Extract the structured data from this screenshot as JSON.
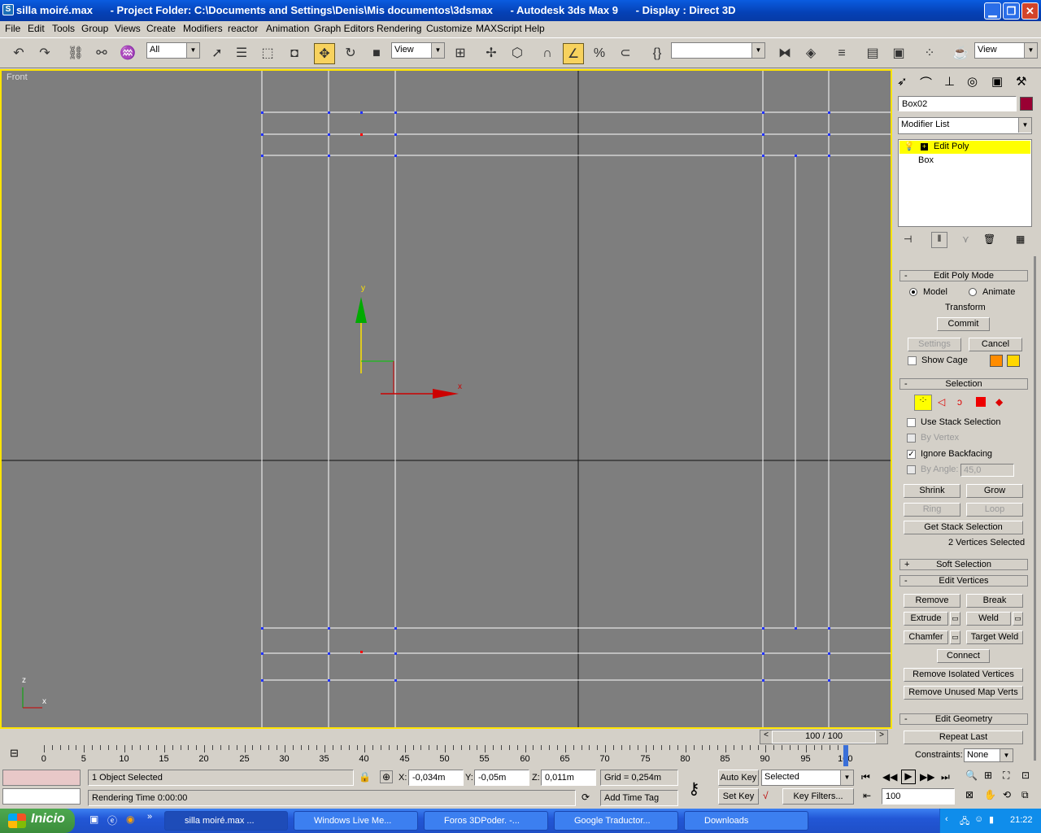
{
  "titlebar": {
    "title": "silla moiré.max      - Project Folder: C:\\Documents and Settings\\Denis\\Mis documentos\\3dsmax      - Autodesk 3ds Max 9      - Display : Direct 3D"
  },
  "menubar": {
    "items": [
      "File",
      "Edit",
      "Tools",
      "Group",
      "Views",
      "Create",
      "Modifiers",
      "reactor",
      "Animation",
      "Graph Editors",
      "Rendering",
      "Customize",
      "MAXScript",
      "Help"
    ]
  },
  "toolbar": {
    "selection_filter": "All",
    "ref_coord": "View",
    "named_sel": "",
    "view_combo": "View"
  },
  "viewport": {
    "label": "Front",
    "gizmo_x": "x",
    "gizmo_y": "y",
    "axis_z": "z",
    "axis_x": "x"
  },
  "cmdpanel": {
    "object_name": "Box02",
    "object_color": "#990033",
    "modifier_list": "Modifier List",
    "stack": [
      "Edit Poly",
      "Box"
    ],
    "edit_poly_mode": {
      "title": "Edit Poly Mode",
      "model": "Model",
      "animate": "Animate",
      "transform": "Transform",
      "commit": "Commit",
      "settings": "Settings",
      "cancel": "Cancel",
      "show_cage": "Show Cage"
    },
    "selection": {
      "title": "Selection",
      "use_stack": "Use Stack Selection",
      "by_vertex": "By Vertex",
      "ignore_backfacing": "Ignore Backfacing",
      "by_angle": "By Angle:",
      "angle_value": "45,0",
      "shrink": "Shrink",
      "grow": "Grow",
      "ring": "Ring",
      "loop": "Loop",
      "get_stack": "Get Stack Selection",
      "status": "2 Vertices Selected"
    },
    "soft_selection": {
      "title": "Soft Selection"
    },
    "edit_vertices": {
      "title": "Edit Vertices",
      "remove": "Remove",
      "break": "Break",
      "extrude": "Extrude",
      "weld": "Weld",
      "chamfer": "Chamfer",
      "target_weld": "Target Weld",
      "connect": "Connect",
      "remove_isolated": "Remove Isolated Vertices",
      "remove_unused": "Remove Unused Map Verts"
    },
    "edit_geometry": {
      "title": "Edit Geometry",
      "repeat_last": "Repeat Last",
      "constraints": "Constraints:",
      "constraints_value": "None"
    }
  },
  "timeslider": {
    "label": "100 / 100",
    "progress": 1.0
  },
  "ruler": {
    "labels": [
      "0",
      "5",
      "10",
      "15",
      "20",
      "25",
      "30",
      "35",
      "40",
      "45",
      "50",
      "55",
      "60",
      "65",
      "70",
      "75",
      "80",
      "85",
      "90",
      "95",
      "100"
    ]
  },
  "status": {
    "objects": "1 Object Selected",
    "render_time": "Rendering Time  0:00:00",
    "x_label": "X:",
    "x": "-0,034m",
    "y_label": "Y:",
    "y": "-0,05m",
    "z_label": "Z:",
    "z": "0,011m",
    "grid": "Grid = 0,254m",
    "add_time_tag": "Add Time Tag",
    "auto_key": "Auto Key",
    "set_key": "Set Key",
    "key_mode": "Selected",
    "key_filters": "Key Filters...",
    "frame": "100"
  },
  "taskbar": {
    "start": "Inicio",
    "tasks": [
      "silla moiré.max     ...",
      "Windows Live Me...",
      "Foros 3DPoder. -...",
      "Google Traductor...",
      "Downloads"
    ],
    "clock": "21:22"
  }
}
